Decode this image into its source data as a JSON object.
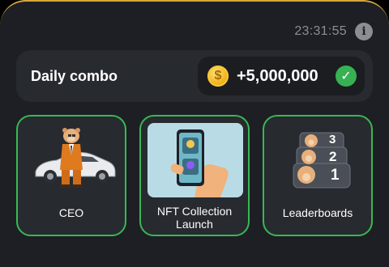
{
  "header": {
    "timer": "23:31:55",
    "info_icon": "info-icon"
  },
  "combo": {
    "title": "Daily combo",
    "coin_icon": "coin-icon",
    "reward": "+5,000,000",
    "check_icon": "check-icon"
  },
  "cards": [
    {
      "label": "CEO",
      "image": "hamster-car-image"
    },
    {
      "label": "NFT Collection Launch",
      "image": "phone-nft-image"
    },
    {
      "label": "Leaderboards",
      "image": "leaderboard-image",
      "ranks": [
        "3",
        "2",
        "1"
      ]
    }
  ],
  "colors": {
    "panel": "#1d1f24",
    "card_border": "#39b852",
    "accent_gold": "#d7a63c",
    "check_green": "#37b153"
  }
}
